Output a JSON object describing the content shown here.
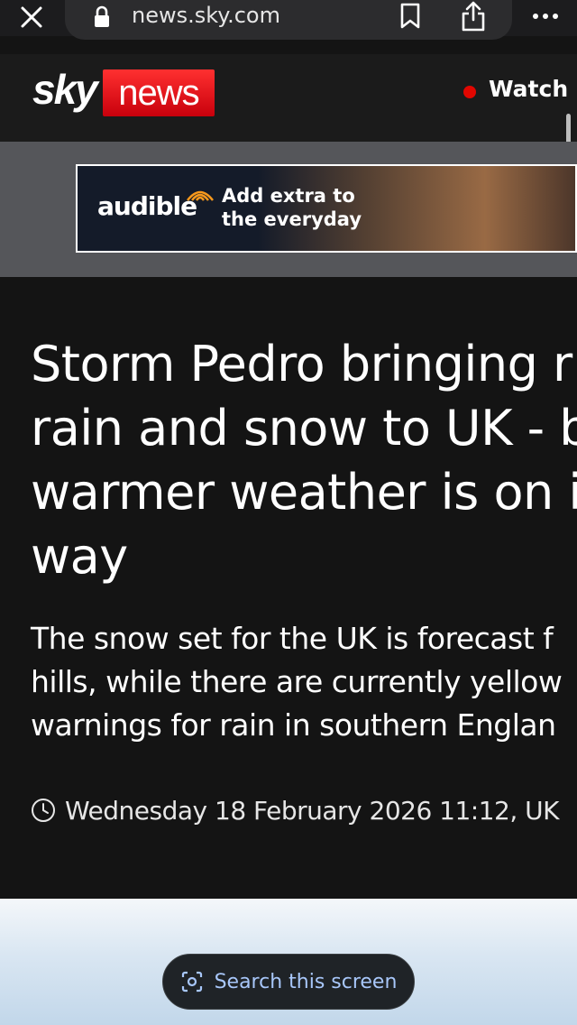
{
  "browser": {
    "url": "news.sky.com",
    "icons": [
      "close-icon",
      "lock-icon",
      "bookmark-icon",
      "share-icon",
      "more-icon"
    ]
  },
  "site_header": {
    "logo_sky": "sky",
    "logo_news": "news",
    "watch_live_label": "Watch L",
    "live_dot_color": "#e10600",
    "logo_red": "#e4000f"
  },
  "ad": {
    "brand": "audible",
    "tagline": "Add extra to the everyday"
  },
  "article": {
    "headline_lines": [
      "Storm Pedro bringing r",
      "rain and snow to UK - b",
      "warmer weather is on i",
      "way"
    ],
    "standfirst_lines": [
      "The snow set for the UK is forecast f",
      "hills, while there are currently yellow",
      "warnings for rain in southern Englan"
    ],
    "timestamp": "Wednesday 18 February 2026 11:12, UK"
  },
  "search_overlay": {
    "label": "Search this screen",
    "icon": "lens-icon",
    "accent": "#a8c7fa"
  }
}
